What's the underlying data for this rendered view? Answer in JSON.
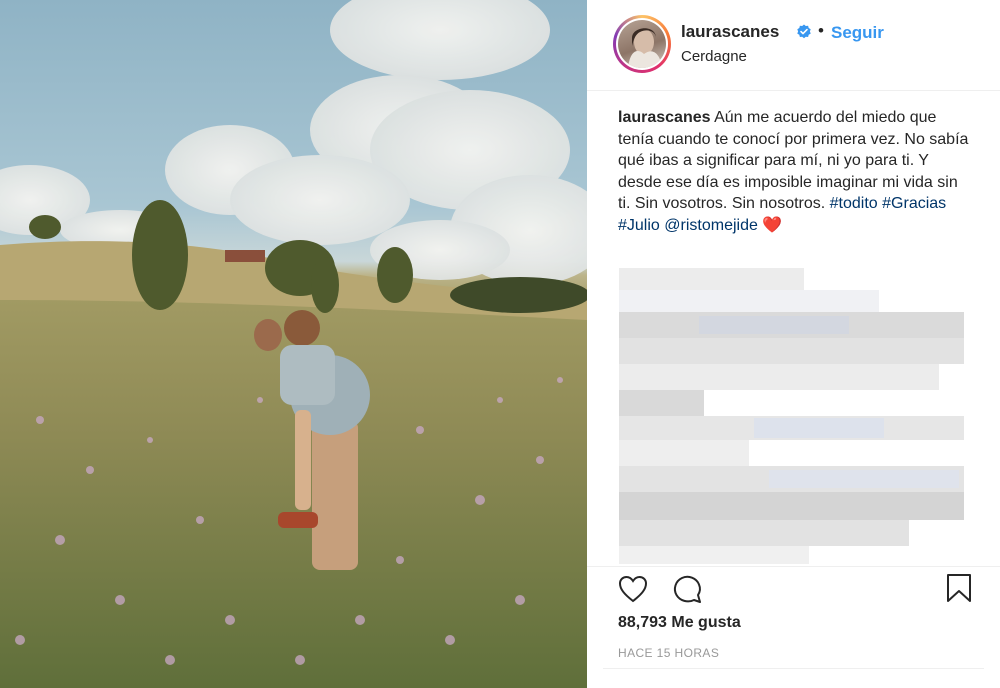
{
  "post": {
    "username": "laurascanes",
    "follow_label": "Seguir",
    "dot": "•",
    "location": "Cerdagne"
  },
  "caption": {
    "username": "laurascanes",
    "text": "Aún me acuerdo del miedo que tenía cuando te conocí por primera vez. No sabía qué ibas a significar para mí, ni yo para ti. Y desde ese día es imposible imaginar mi vida sin ti. Sin vosotros. Sin nosotros. ",
    "hashtags": [
      "#todito",
      "#Gracias",
      "#Julio"
    ],
    "mention": "@ristomejide",
    "emoji": "❤️"
  },
  "engagement": {
    "likes": "88,793 Me gusta",
    "timestamp": "HACE 15 HORAS"
  },
  "icons": {
    "verified": "verified-badge-icon",
    "like": "heart-icon",
    "comment": "comment-icon",
    "save": "bookmark-icon"
  },
  "colors": {
    "link_blue": "#3897f0",
    "hashtag_blue": "#003569",
    "verified_blue": "#3897f0",
    "text": "#262626",
    "muted": "#999999"
  }
}
